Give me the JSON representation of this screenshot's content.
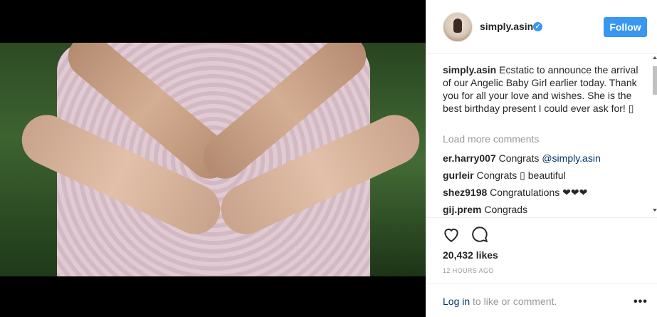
{
  "post": {
    "username": "simply.asin",
    "verified_icon": "verified-badge-icon",
    "follow_label": "Follow",
    "caption": {
      "username": "simply.asin",
      "text": " Ecstatic to announce the arrival of our Angelic Baby Girl earlier today. Thank you for all your love and wishes. She is the best birthday present I could ever ask for! ▯"
    },
    "load_more_label": "Load more comments",
    "comments": [
      {
        "user": "er.harry007",
        "text": " Congrats ",
        "mention": "@simply.asin"
      },
      {
        "user": "gurleir",
        "text": " Congrats ▯ beautiful",
        "mention": ""
      },
      {
        "user": "shez9198",
        "text": " Congratulations ❤❤❤",
        "mention": ""
      },
      {
        "user": "gij.prem",
        "text": " Congrads",
        "mention": ""
      }
    ],
    "likes": "20,432 likes",
    "timestamp": "12 HOURS AGO",
    "login_link": "Log in",
    "login_rest": " to like or comment.",
    "more_icon": "•••"
  },
  "colors": {
    "accent": "#3897f0",
    "link": "#003569",
    "muted": "#999999"
  }
}
